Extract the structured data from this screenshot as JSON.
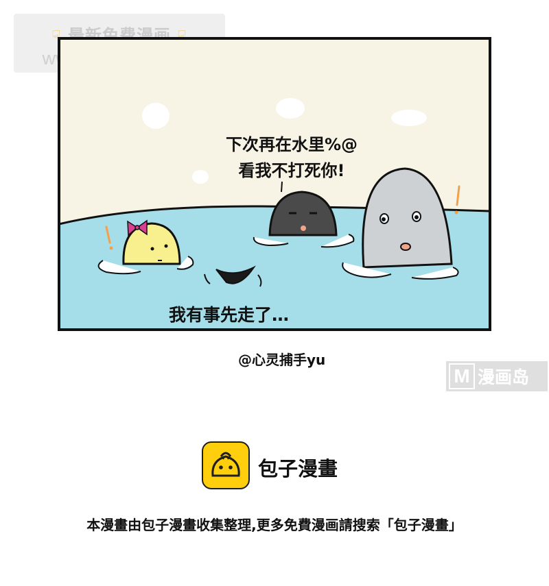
{
  "watermark": {
    "line1": "最新免费漫画",
    "line2": "www.baozimh.com"
  },
  "panel": {
    "speech_line1": "下次再在水里%@",
    "speech_line2": "看我不打死你!",
    "caption": "我有事先走了…"
  },
  "credit": "@心灵捕手yu",
  "site_badge": {
    "letter": "M",
    "text": "漫画岛"
  },
  "footer": {
    "logo_name": "包子漫畫",
    "notice": "本漫畫由包子漫畫收集整理,更多免費漫画請搜索「包子漫畫」"
  },
  "colors": {
    "sky": "#f7f4e6",
    "water": "#a5dde8",
    "yellow_char": "#f8f08e",
    "gray_char": "#cdd1d4",
    "dark_char": "#4a4a4a",
    "logo_yellow": "#ffcf0d",
    "accent_orange": "#f3a04a"
  }
}
